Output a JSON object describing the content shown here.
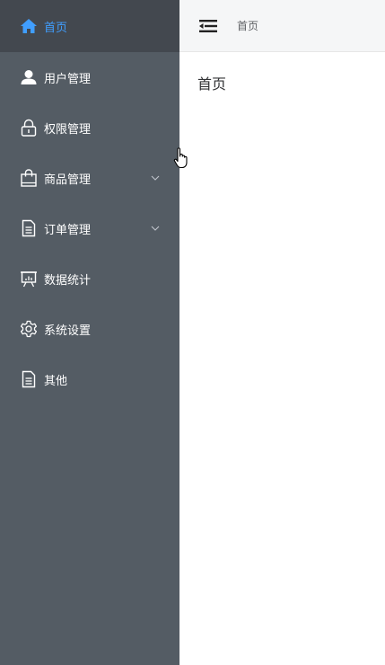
{
  "sidebar": {
    "items": [
      {
        "label": "首页",
        "icon": "home-icon"
      },
      {
        "label": "用户管理",
        "icon": "user-icon"
      },
      {
        "label": "权限管理",
        "icon": "lock-icon"
      },
      {
        "label": "商品管理",
        "icon": "shopping-bag-icon"
      },
      {
        "label": "订单管理",
        "icon": "document-icon"
      },
      {
        "label": "数据统计",
        "icon": "presentation-board-icon"
      },
      {
        "label": "系统设置",
        "icon": "gear-icon"
      },
      {
        "label": "其他",
        "icon": "document-icon"
      }
    ]
  },
  "header": {
    "breadcrumb": "首页",
    "toggle_icon": "collapse-menu-icon"
  },
  "main": {
    "title": "首页"
  },
  "colors": {
    "sidebar_bg": "#545c64",
    "active_bg": "#43484f",
    "active_text": "#409eff",
    "header_bg": "#f5f6f7"
  }
}
